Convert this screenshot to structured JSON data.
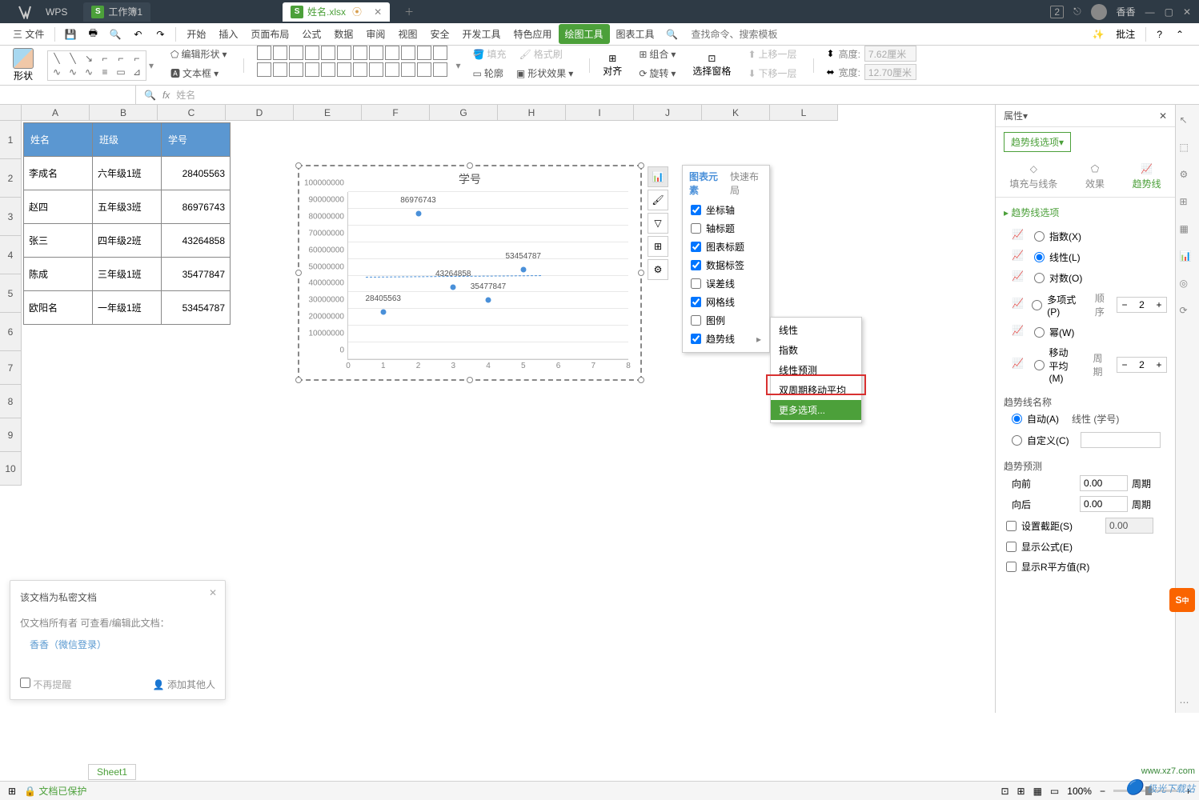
{
  "app": {
    "name": "WPS"
  },
  "tabs": {
    "t1": "工作簿1",
    "t2": "姓名.xlsx"
  },
  "windowControls": {
    "badge": "2"
  },
  "user": {
    "name": "香香"
  },
  "menus": {
    "file": "三 文件",
    "start": "开始",
    "insert": "插入",
    "pageLayout": "页面布局",
    "formula": "公式",
    "data": "数据",
    "review": "审阅",
    "view": "视图",
    "security": "安全",
    "devTools": "开发工具",
    "special": "特色应用",
    "drawingTools": "绘图工具",
    "chartTools": "图表工具",
    "search": "查找命令、搜索模板",
    "batch": "批注",
    "help": "?"
  },
  "ribbon": {
    "shapes": "形状",
    "editShape": "编辑形状",
    "textBox": "文本框",
    "fill": "填充",
    "formatPainter": "格式刷",
    "outline": "轮廓",
    "shapeEffect": "形状效果",
    "align": "对齐",
    "rotate": "旋转",
    "combine": "组合",
    "selectPane": "选择窗格",
    "moveUp": "上移一层",
    "moveDown": "下移一层",
    "height": "高度:",
    "width": "宽度:",
    "hVal": "7.62厘米",
    "wVal": "12.70厘米"
  },
  "formulaBar": {
    "fx": "fx",
    "value": "姓名"
  },
  "columns": [
    "A",
    "B",
    "C",
    "D",
    "E",
    "F",
    "G",
    "H",
    "I",
    "J",
    "K",
    "L"
  ],
  "rows": [
    "1",
    "2",
    "3",
    "4",
    "5",
    "6",
    "7",
    "8",
    "9",
    "10"
  ],
  "table": {
    "headers": [
      "姓名",
      "班级",
      "学号"
    ],
    "rows": [
      [
        "李成名",
        "六年级1班",
        "28405563"
      ],
      [
        "赵四",
        "五年级3班",
        "86976743"
      ],
      [
        "张三",
        "四年级2班",
        "43264858"
      ],
      [
        "陈成",
        "三年级1班",
        "35477847"
      ],
      [
        "欧阳名",
        "一年级1班",
        "53454787"
      ]
    ]
  },
  "chart_data": {
    "type": "scatter",
    "title": "学号",
    "x": [
      1,
      2,
      3,
      4,
      5
    ],
    "y": [
      28405563,
      86976743,
      43264858,
      35477847,
      53454787
    ],
    "data_labels": [
      "28405563",
      "86976743",
      "43264858",
      "35477847",
      "53454787"
    ],
    "xlim": [
      0,
      8
    ],
    "ylim": [
      0,
      100000000
    ],
    "xticks": [
      0,
      1,
      2,
      3,
      4,
      5,
      6,
      7,
      8
    ],
    "yticks": [
      0,
      10000000,
      20000000,
      30000000,
      40000000,
      50000000,
      60000000,
      70000000,
      80000000,
      90000000,
      100000000
    ],
    "trendline": {
      "type": "linear"
    }
  },
  "chartElements": {
    "tab1": "图表元素",
    "tab2": "快速布局",
    "axis": "坐标轴",
    "axisTitle": "轴标题",
    "chartTitle": "图表标题",
    "dataLabel": "数据标签",
    "errorBar": "误差线",
    "gridlines": "网格线",
    "legend": "图例",
    "trendline": "趋势线"
  },
  "trendMenu": {
    "linear": "线性",
    "exp": "指数",
    "linearForecast": "线性预测",
    "movingAvg": "双周期移动平均",
    "more": "更多选项..."
  },
  "panel": {
    "title": "属性",
    "dropdown": "趋势线选项",
    "tab1": "填充与线条",
    "tab2": "效果",
    "tab3": "趋势线",
    "section": "趋势线选项",
    "exp": "指数(X)",
    "linear": "线性(L)",
    "log": "对数(O)",
    "poly": "多项式(P)",
    "order": "顺序",
    "orderVal": "2",
    "power": "幂(W)",
    "movAvg": "移动\n平均(M)",
    "period": "周期",
    "periodVal": "2",
    "nameSection": "趋势线名称",
    "auto": "自动(A)",
    "autoVal": "线性 (学号)",
    "custom": "自定义(C)",
    "forecastSection": "趋势预测",
    "forward": "向前",
    "backward": "向后",
    "fwdVal": "0.00",
    "bwdVal": "0.00",
    "periodUnit": "周期",
    "intercept": "设置截距(S)",
    "interceptVal": "0.00",
    "showFormula": "显示公式(E)",
    "showR2": "显示R平方值(R)"
  },
  "infoPopup": {
    "title": "该文档为私密文档",
    "desc": "仅文档所有者 可查看/编辑此文档：",
    "owner": "香香（微信登录）",
    "dontRemind": "不再提醒",
    "addOthers": "添加其他人"
  },
  "status": {
    "sheet": "Sheet1",
    "protected": "文档已保护",
    "zoom": "100%"
  },
  "watermark": {
    "site": "极光下载站",
    "url": "www.xz7.com"
  }
}
